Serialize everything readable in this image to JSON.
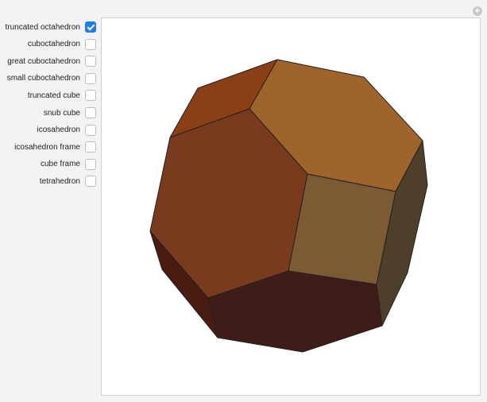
{
  "controls": [
    {
      "label": "truncated octahedron",
      "checked": true
    },
    {
      "label": "cuboctahedron",
      "checked": false
    },
    {
      "label": "great cuboctahedron",
      "checked": false
    },
    {
      "label": "small cuboctahedron",
      "checked": false
    },
    {
      "label": "truncated cube",
      "checked": false
    },
    {
      "label": "snub cube",
      "checked": false
    },
    {
      "label": "icosahedron",
      "checked": false
    },
    {
      "label": "icosahedron frame",
      "checked": false
    },
    {
      "label": "cube frame",
      "checked": false
    },
    {
      "label": "tetrahedron",
      "checked": false
    }
  ],
  "plus_symbol": "+",
  "colors": {
    "checkbox_accent": "#1d7cf2",
    "face_top_left": "#8a3f14",
    "face_top": "#9e642c",
    "face_left_hexagon": "#7a3a1e",
    "face_front_square": "#7b5a34",
    "face_right": "#4d3f2a",
    "face_bottom_left": "#4a1b0f",
    "face_bottom": "#3e1c17",
    "edge": "#222222"
  }
}
